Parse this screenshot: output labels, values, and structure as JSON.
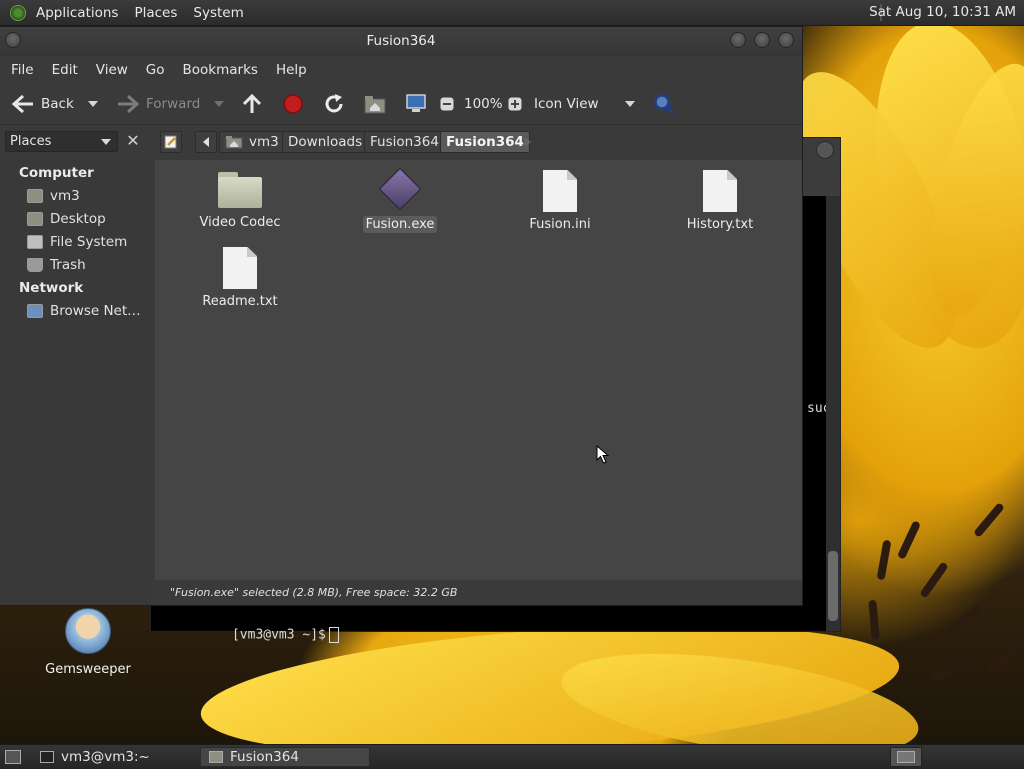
{
  "top_panel": {
    "menus": [
      "Applications",
      "Places",
      "System"
    ],
    "clock": "Sat Aug 10, 10:31 AM"
  },
  "terminal": {
    "prompt": "[vm3@vm3 ~]$",
    "fragment": "suc"
  },
  "file_manager": {
    "title": "Fusion364",
    "menu": [
      "File",
      "Edit",
      "View",
      "Go",
      "Bookmarks",
      "Help"
    ],
    "toolbar": {
      "back": "Back",
      "forward": "Forward",
      "zoom": "100%",
      "view_mode": "Icon View"
    },
    "sidebar_combo": "Places",
    "breadcrumbs": [
      "vm3",
      "Downloads",
      "Fusion364",
      "Fusion364"
    ],
    "sidebar": {
      "computer_header": "Computer",
      "computer_items": [
        "vm3",
        "Desktop",
        "File System",
        "Trash"
      ],
      "network_header": "Network",
      "network_items": [
        "Browse Net…"
      ]
    },
    "files": [
      {
        "name": "Video Codec",
        "type": "folder"
      },
      {
        "name": "Fusion.exe",
        "type": "executable"
      },
      {
        "name": "Fusion.ini",
        "type": "file"
      },
      {
        "name": "History.txt",
        "type": "file"
      },
      {
        "name": "Readme.txt",
        "type": "file"
      }
    ],
    "status": "\"Fusion.exe\" selected (2.8 MB), Free space: 32.2 GB"
  },
  "desktop": {
    "icon_label": "Gemsweeper"
  },
  "taskbar": {
    "tasks": [
      "vm3@vm3:~",
      "Fusion364"
    ]
  }
}
